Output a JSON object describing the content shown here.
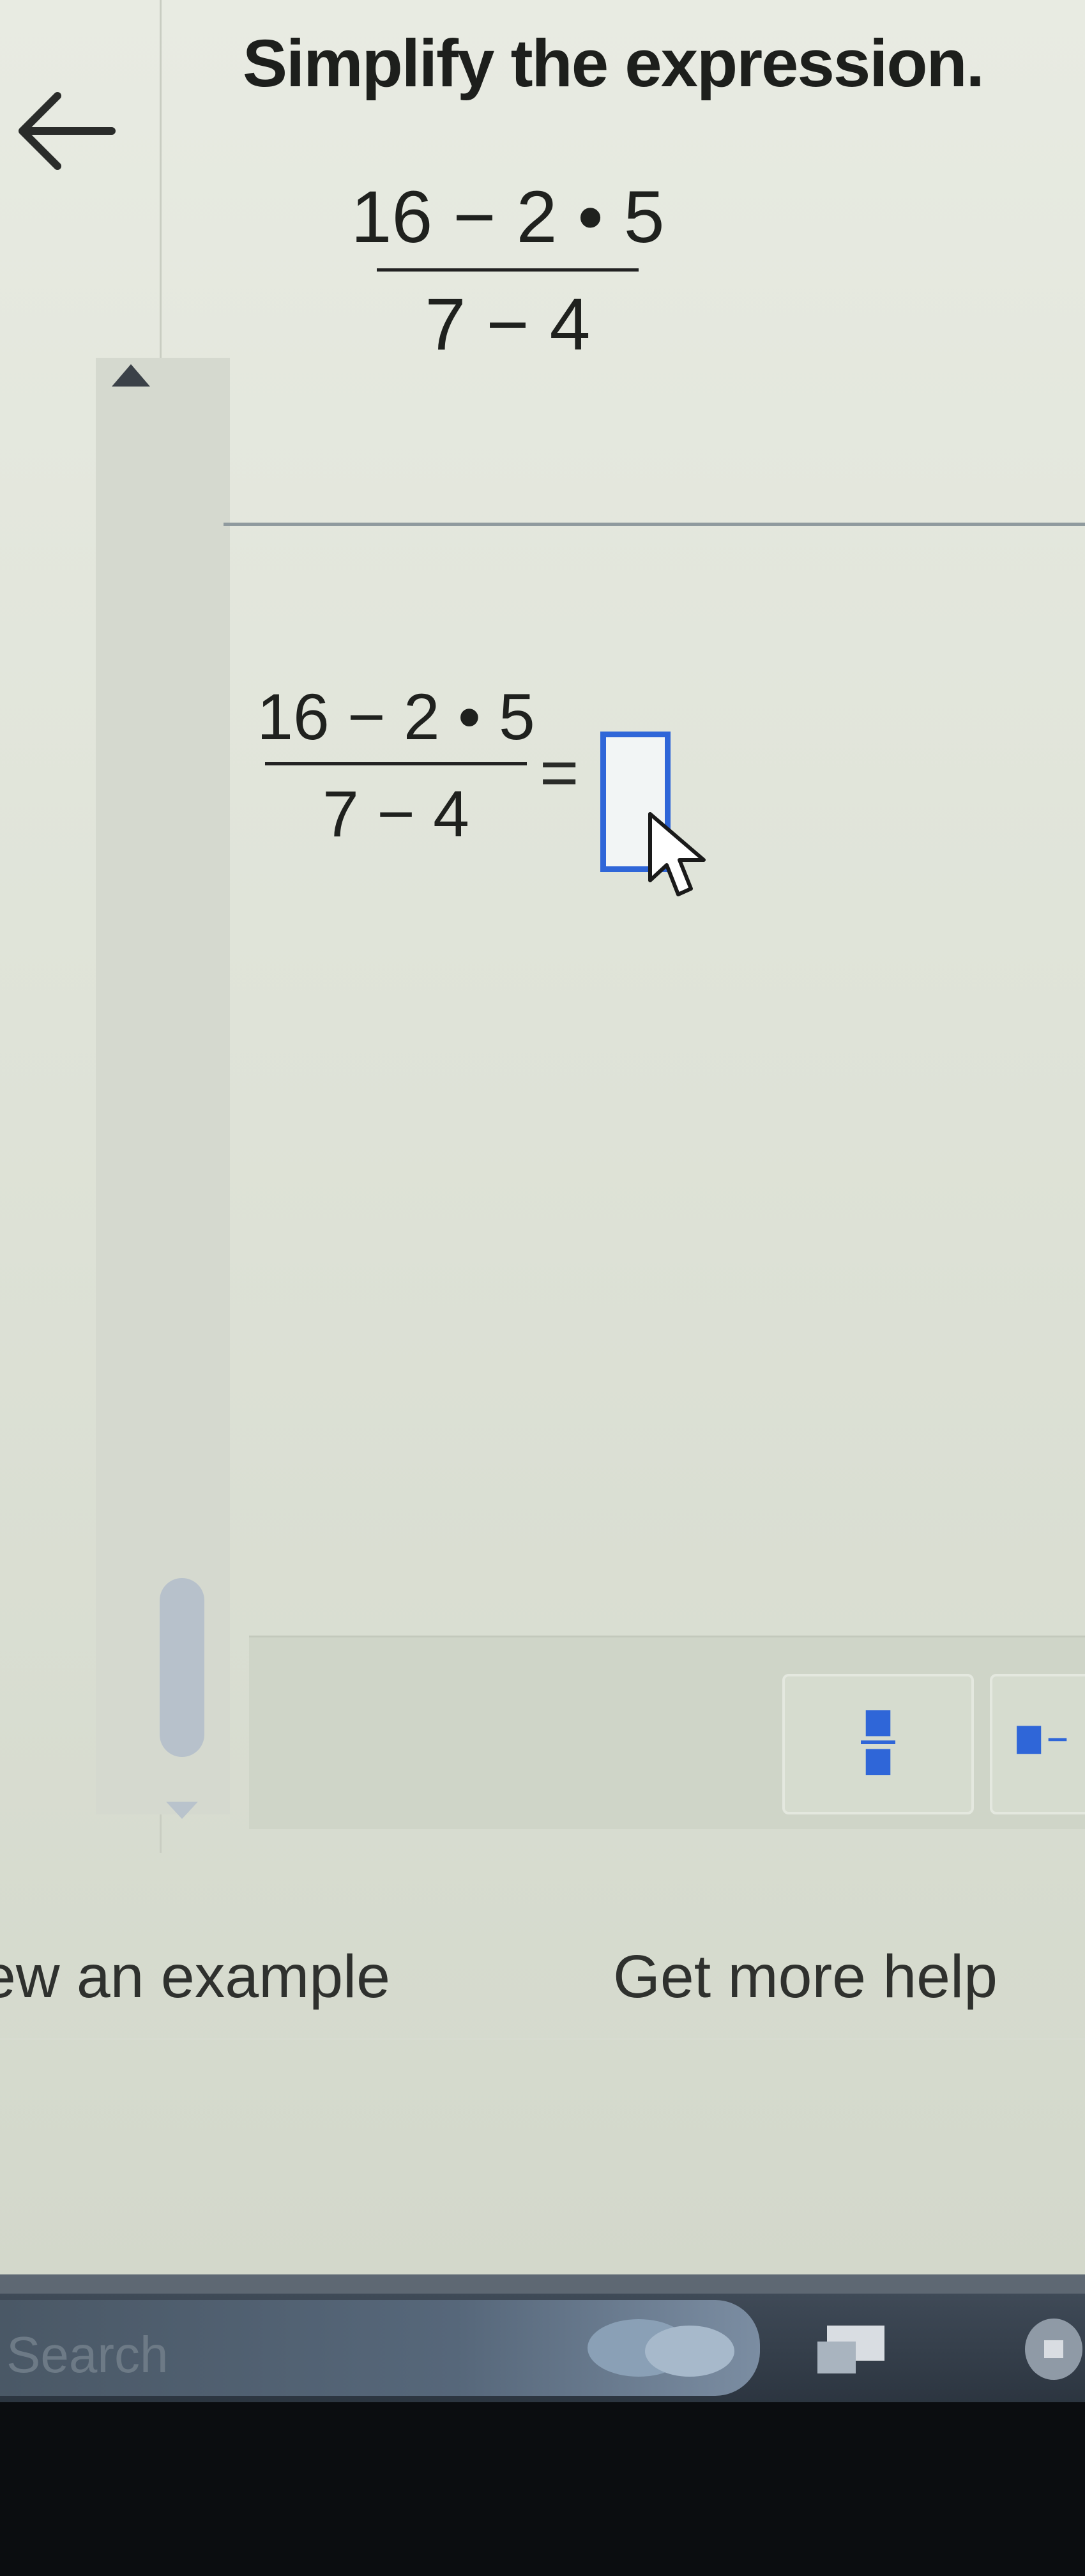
{
  "question": {
    "title": "Simplify the expression.",
    "expression": {
      "numerator": "16 − 2 • 5",
      "denominator": "7 − 4"
    }
  },
  "answer": {
    "expression": {
      "numerator": "16 − 2 • 5",
      "denominator": "7 − 4"
    },
    "equals": "=",
    "input_value": ""
  },
  "footer": {
    "view_example_label": "ew an example",
    "more_help_label": "Get more help"
  },
  "taskbar": {
    "search_placeholder": "Search"
  },
  "colors": {
    "answer_box_border": "#2f66d8",
    "scroll_thumb": "#b7c1cb",
    "taskbar": "#2c3540"
  },
  "icons": [
    "back-arrow-icon",
    "scroll-up-icon",
    "scroll-down-icon",
    "fraction-icon",
    "mixed-number-icon",
    "mouse-pointer-icon"
  ]
}
